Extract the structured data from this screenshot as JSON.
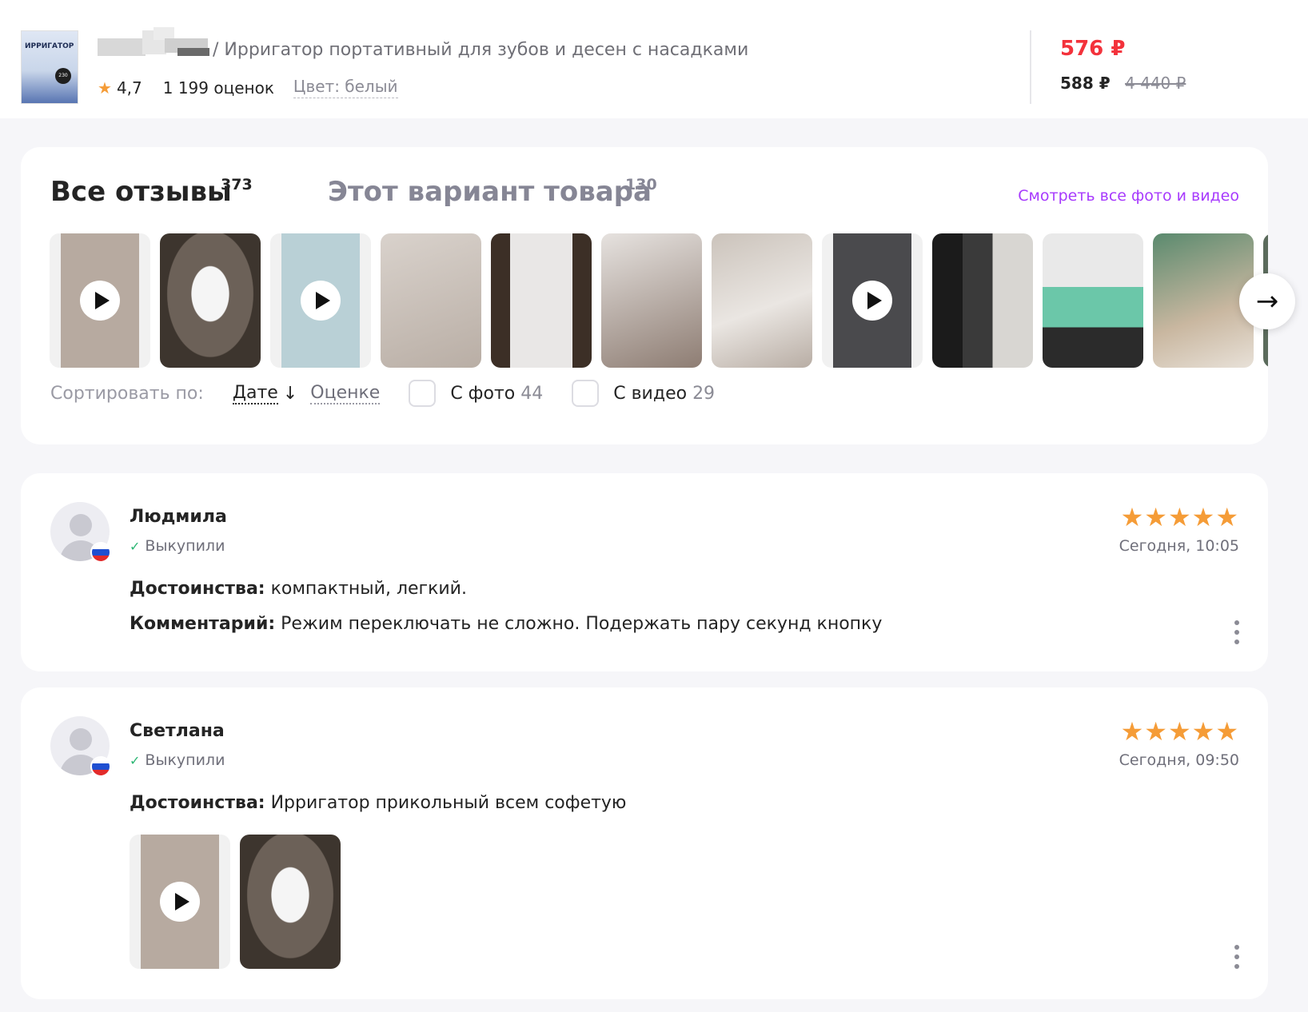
{
  "product": {
    "thumb_text": "ИРРИГАТОР",
    "thumb_badge": "230",
    "title": "/ Ирригатор портативный для зубов и десен с насадками",
    "rating": "4,7",
    "ratings_count": "1 199 оценок",
    "color": "Цвет: белый",
    "price": "576 ₽",
    "price_alt": "588 ₽",
    "price_old": "4 440 ₽"
  },
  "tabs": {
    "all_label": "Все отзывы",
    "all_count": "373",
    "variant_label": "Этот вариант товара",
    "variant_count": "130",
    "see_all": "Смотреть все фото и видео"
  },
  "gallery": {
    "items": [
      {
        "video": true
      },
      {
        "video": false
      },
      {
        "video": true
      },
      {
        "video": false
      },
      {
        "video": false
      },
      {
        "video": false
      },
      {
        "video": false
      },
      {
        "video": true
      },
      {
        "video": false
      },
      {
        "video": false
      },
      {
        "video": false
      }
    ],
    "next_arrow": "→"
  },
  "sort": {
    "label": "Сортировать по:",
    "by_date": "Дате",
    "date_arrow": "↓",
    "by_rating": "Оценке",
    "with_photo_label": "С фото",
    "with_photo_count": "44",
    "with_video_label": "С видео",
    "with_video_count": "29"
  },
  "reviews": [
    {
      "name": "Людмила",
      "bought": "Выкупили",
      "stars": "★★★★★",
      "rating": 5,
      "date": "Сегодня, 10:05",
      "pros_label": "Достоинства:",
      "pros": " компактный, легкий.",
      "comment_label": "Комментарий:",
      "comment": " Режим переключать не сложно. Подержать пару секунд кнопку"
    },
    {
      "name": "Светлана",
      "bought": "Выкупили",
      "stars": "★★★★★",
      "rating": 5,
      "date": "Сегодня, 09:50",
      "pros_label": "Достоинства:",
      "pros": " Ирригатор прикольный всем софетую"
    }
  ],
  "colors": {
    "price_red": "#f3323b",
    "accent_purple": "#a73afd",
    "star_orange": "#f59c37",
    "check_green": "#2bb673"
  },
  "icons": {
    "star": "star-icon",
    "check": "check-icon",
    "play": "play-icon",
    "arrow": "arrow-right-icon",
    "kebab": "kebab-menu-icon",
    "flag": "russia-flag-icon"
  }
}
